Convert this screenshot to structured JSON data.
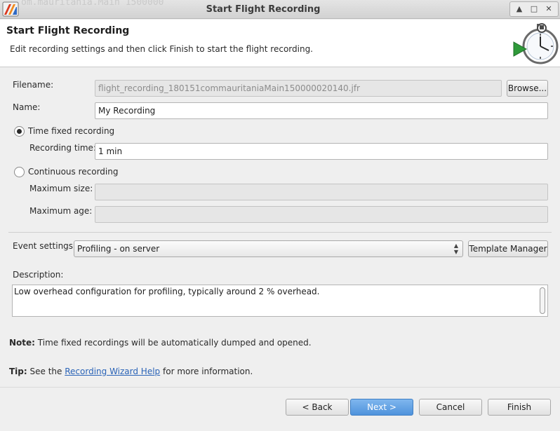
{
  "window": {
    "title": "Start Flight Recording",
    "background_text": "om.mauritania.Main 1500000",
    "controls": {
      "up": "▲",
      "maximize": "□",
      "close": "✕"
    }
  },
  "header": {
    "title": "Start Flight Recording",
    "subtitle": "Edit recording settings and then click Finish to start the flight recording.",
    "icon": "stopwatch-play-icon"
  },
  "form": {
    "filename_label": "Filename:",
    "filename_value": "flight_recording_180151commauritaniaMain150000020140.jfr",
    "browse_label": "Browse...",
    "name_label": "Name:",
    "name_value": "My Recording",
    "time_fixed_label": "Time fixed recording",
    "time_fixed_selected": true,
    "recording_time_label": "Recording time:",
    "recording_time_value": "1 min",
    "continuous_label": "Continuous recording",
    "continuous_selected": false,
    "max_size_label": "Maximum size:",
    "max_size_value": "",
    "max_age_label": "Maximum age:",
    "max_age_value": "",
    "event_settings_label": "Event settings:",
    "event_settings_value": "Profiling - on server",
    "template_manager_label": "Template Manager",
    "description_label": "Description:",
    "description_value": "Low overhead configuration for profiling, typically around 2 % overhead."
  },
  "notes": {
    "note_prefix": "Note:",
    "note_text": "Time fixed recordings will be automatically dumped and opened.",
    "tip_prefix": "Tip:",
    "tip_before": "See the",
    "tip_link": "Recording Wizard Help",
    "tip_after": "for more information."
  },
  "buttons": {
    "back": "< Back",
    "next": "Next >",
    "cancel": "Cancel",
    "finish": "Finish"
  },
  "colors": {
    "accent": "#4f93dc",
    "link": "#2a63b7"
  }
}
